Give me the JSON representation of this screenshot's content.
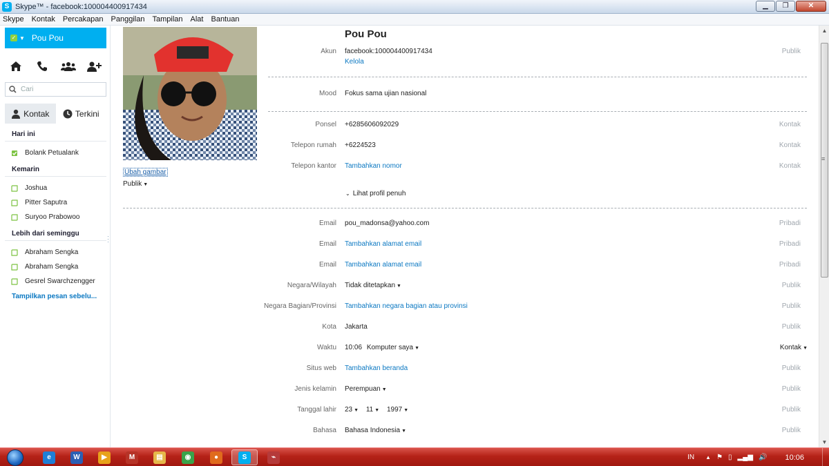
{
  "window": {
    "title": "Skype™ - facebook:100004400917434",
    "app_icon": "skype-icon"
  },
  "menu": [
    "Skype",
    "Kontak",
    "Percakapan",
    "Panggilan",
    "Tampilan",
    "Alat",
    "Bantuan"
  ],
  "sidebar": {
    "profile_name": "Pou Pou",
    "status_color": "#8fd13f",
    "accent": "#00aff0",
    "search_placeholder": "Cari",
    "tabs": [
      {
        "label": "Kontak"
      },
      {
        "label": "Terkini"
      }
    ],
    "groups": [
      {
        "title": "Hari ini",
        "items": [
          {
            "name": "Bolank Petualank",
            "status": "online"
          }
        ]
      },
      {
        "title": "Kemarin",
        "items": [
          {
            "name": "Joshua",
            "status": "offline"
          },
          {
            "name": "Pitter Saputra",
            "status": "offline"
          },
          {
            "name": "Suryoo Prabowoo",
            "status": "offline"
          }
        ]
      },
      {
        "title": "Lebih dari seminggu",
        "items": [
          {
            "name": "Abraham Sengka",
            "status": "offline"
          },
          {
            "name": "Abraham Sengka",
            "status": "offline"
          },
          {
            "name": "Gesrel Swarchzengger",
            "status": "offline"
          }
        ]
      }
    ],
    "more_link": "Tampilkan pesan sebelu..."
  },
  "profile": {
    "change_picture": "Ubah gambar",
    "picture_visibility": "Publik",
    "name": "Pou Pou",
    "account": {
      "label": "Akun",
      "value": "facebook:100004400917434",
      "manage": "Kelola",
      "visibility": "Publik"
    },
    "mood": {
      "label": "Mood",
      "value": "Fokus sama ujian nasional"
    },
    "phones": [
      {
        "label": "Ponsel",
        "value": "+6285606092029",
        "visibility": "Kontak",
        "link": false
      },
      {
        "label": "Telepon rumah",
        "value": "+6224523",
        "visibility": "Kontak",
        "link": false
      },
      {
        "label": "Telepon kantor",
        "value": "Tambahkan nomor",
        "visibility": "Kontak",
        "link": true
      }
    ],
    "full_profile": "Lihat profil penuh",
    "details": [
      {
        "label": "Email",
        "value": "pou_madonsa@yahoo.com",
        "visibility": "Pribadi",
        "link": false
      },
      {
        "label": "Email",
        "value": "Tambahkan alamat email",
        "visibility": "Pribadi",
        "link": true
      },
      {
        "label": "Email",
        "value": "Tambahkan alamat email",
        "visibility": "Pribadi",
        "link": true
      },
      {
        "label": "Negara/Wilayah",
        "value": "Tidak ditetapkan",
        "visibility": "Publik",
        "link": false,
        "dropdown": true
      },
      {
        "label": "Negara Bagian/Provinsi",
        "value": "Tambahkan negara bagian atau provinsi",
        "visibility": "Publik",
        "link": true
      },
      {
        "label": "Kota",
        "value": "Jakarta",
        "visibility": "Publik",
        "link": false
      }
    ],
    "time": {
      "label": "Waktu",
      "value": "10:06",
      "source": "Komputer saya",
      "visibility": "Kontak"
    },
    "website": {
      "label": "Situs web",
      "value": "Tambahkan beranda",
      "visibility": "Publik"
    },
    "gender": {
      "label": "Jenis kelamin",
      "value": "Perempuan",
      "visibility": "Publik"
    },
    "birthday": {
      "label": "Tanggal lahir",
      "day": "23",
      "month": "11",
      "year": "1997",
      "visibility": "Publik"
    },
    "language": {
      "label": "Bahasa",
      "value": "Bahasa Indonesia",
      "visibility": "Publik"
    }
  },
  "taskbar": {
    "apps": [
      {
        "icon": "ie-icon",
        "color": "#1f7fd6",
        "glyph": "e"
      },
      {
        "icon": "word-icon",
        "color": "#2b5fb4",
        "glyph": "W"
      },
      {
        "icon": "media-player-icon",
        "color": "#e8a21a",
        "glyph": "▶"
      },
      {
        "icon": "gmail-icon",
        "color": "#b63327",
        "glyph": "M"
      },
      {
        "icon": "explorer-icon",
        "color": "#e6b84a",
        "glyph": "▤"
      },
      {
        "icon": "chrome-icon",
        "color": "#3aa34a",
        "glyph": "◉"
      },
      {
        "icon": "firefox-icon",
        "color": "#e06b1d",
        "glyph": "●"
      },
      {
        "icon": "skype-icon",
        "color": "#00aff0",
        "glyph": "S"
      },
      {
        "icon": "app-icon",
        "color": "#b53a3a",
        "glyph": "⌁"
      }
    ],
    "lang": "IN",
    "clock": "10:06"
  }
}
